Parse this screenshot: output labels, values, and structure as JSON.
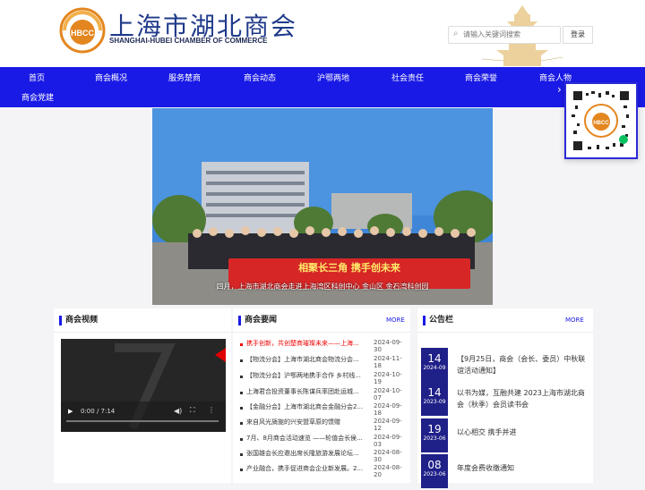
{
  "header": {
    "logo_text_cn": "上海市湖北商会",
    "logo_text_en": "SHANGHAI-HUBEI CHAMBER OF COMMERCE",
    "logo_badge": "HBCC",
    "search": {
      "placeholder": "请输入关键词搜索"
    },
    "login_label": "登录"
  },
  "nav": {
    "items": [
      "首页",
      "商会概况",
      "服务楚商",
      "商会动态",
      "沪鄂两地",
      "社会责任",
      "商会荣誉",
      "商会人物",
      "商会党建"
    ]
  },
  "banner": {
    "caption": "四月，上海市湖北商会走进上海湾区科创中心 金山区 金石湾科创园",
    "banner_text": "相聚长三角 携手创未来",
    "slides": 2
  },
  "video_panel": {
    "title": "商会视频",
    "time": "0:00 / 7:14"
  },
  "news_panel": {
    "title": "商会要闻",
    "more": "MORE",
    "items": [
      {
        "title": "携手创新，共创楚商璀璨未来——上海...",
        "date": "2024-09-30",
        "highlight": true
      },
      {
        "title": "【物流分会】上海市湖北商会物流分会...",
        "date": "2024-11-18"
      },
      {
        "title": "【物流分会】沪鄂两地携手合作 乡村线...",
        "date": "2024-10-19"
      },
      {
        "title": "上海君合投资董事长陈谋兵率团赴运城...",
        "date": "2024-10-07"
      },
      {
        "title": "【金融分会】上海市湖北商会金融分会2...",
        "date": "2024-09-18"
      },
      {
        "title": "来自风光旖旎的兴安盟草原的馈赠",
        "date": "2024-09-12"
      },
      {
        "title": "7月、8月商会活动速览 ——轮值会长侯...",
        "date": "2024-09-03"
      },
      {
        "title": "张国雄会长应邀出席长隆旅游发展论坛...",
        "date": "2024-08-30"
      },
      {
        "title": "产业融合，携手促进商会企业新发展。2...",
        "date": "2024-08-20"
      }
    ]
  },
  "notice_panel": {
    "title": "公告栏",
    "more": "MORE",
    "items": [
      {
        "day": "14",
        "ym": "2024-09",
        "text": "【9月25日，商会（会长、委员）中秋联谊活动通知】"
      },
      {
        "day": "14",
        "ym": "2023-09",
        "text": "以书为媒，互融共建 2023上海市湖北商会（秋季）会员读书会"
      },
      {
        "day": "19",
        "ym": "2023-06",
        "text": "以心相交 携手并进"
      },
      {
        "day": "08",
        "ym": "2023-06",
        "text": "年度会费收缴通知"
      }
    ]
  },
  "colors": {
    "brand_blue": "#1a1ae6",
    "notice_date_bg": "#202089",
    "logo_gold": "#e3861f",
    "hot_red": "#e00000"
  }
}
